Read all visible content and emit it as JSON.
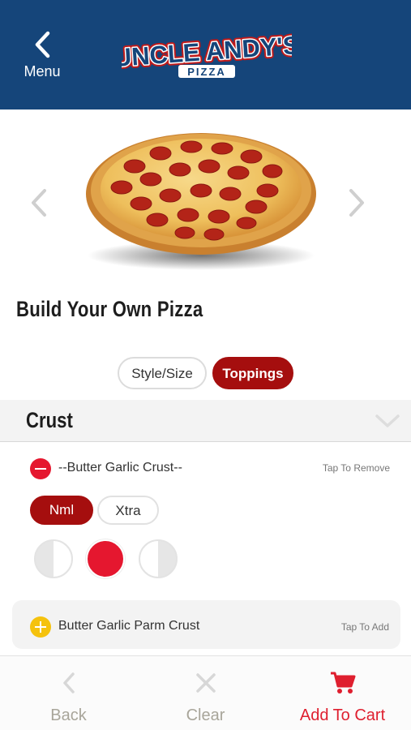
{
  "header": {
    "menu_label": "Menu",
    "logo_text_main": "UNCLE ANDY'S",
    "logo_text_sub": "PIZZA",
    "background": "#15457a"
  },
  "product": {
    "title": "Build Your Own Pizza",
    "image": "pepperoni-pizza"
  },
  "tabs": [
    {
      "label": "Style/Size",
      "selected": false
    },
    {
      "label": "Toppings",
      "selected": true
    }
  ],
  "section": {
    "title": "Crust",
    "expanded": true
  },
  "selected_item": {
    "name": "--Butter Garlic Crust--",
    "action": "Tap To Remove",
    "amounts": [
      {
        "label": "Nml",
        "selected": true
      },
      {
        "label": "Xtra",
        "selected": false
      }
    ],
    "portion_selected": "whole"
  },
  "available_item": {
    "name": "Butter Garlic Parm Crust",
    "action": "Tap To Add"
  },
  "bottom_bar": {
    "back_label": "Back",
    "clear_label": "Clear",
    "cart_label": "Add To Cart"
  },
  "colors": {
    "brand_blue": "#15457a",
    "accent_red": "#a50e0e",
    "bright_red": "#e5172f",
    "add_yellow": "#f5c20d"
  }
}
